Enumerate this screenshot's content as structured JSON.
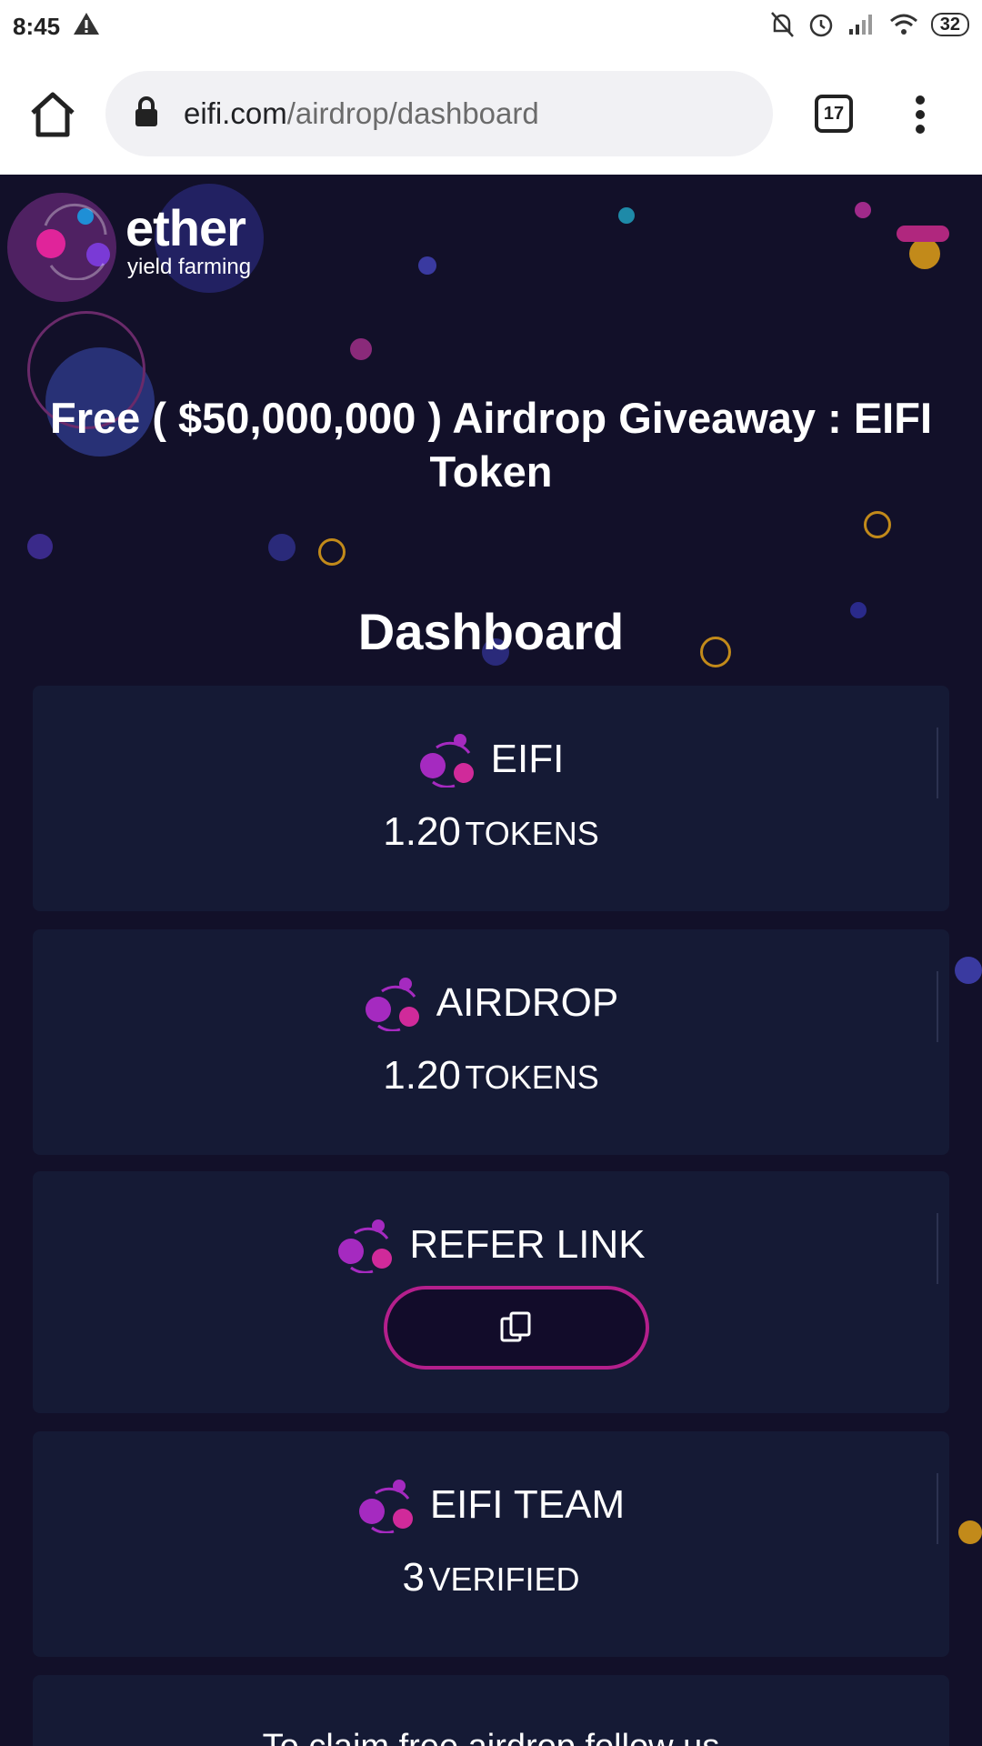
{
  "status": {
    "time": "8:45",
    "battery": "32"
  },
  "browser": {
    "url_host": "eifi.com",
    "url_path": "/airdrop/dashboard",
    "tab_count": "17"
  },
  "logo": {
    "name": "ether",
    "tagline": "yield farming"
  },
  "headline": {
    "line1": "Free ( $50,000,000 ) Airdrop Giveaway : EIFI",
    "line2": "Token"
  },
  "dashboard_title": "Dashboard",
  "cards": [
    {
      "label": "EIFI",
      "value": "1.20",
      "unit": "TOKENS"
    },
    {
      "label": "AIRDROP",
      "value": "1.20",
      "unit": "TOKENS"
    },
    {
      "label": "REFER LINK"
    },
    {
      "label": "EIFI TEAM",
      "value": "3",
      "unit": "VERIFIED"
    }
  ],
  "claim_text": "To claim free airdrop follow us",
  "colors": {
    "background": "#121029",
    "card": "#151a35",
    "accent": "#b41f8c",
    "icon": "#a52ac0"
  }
}
